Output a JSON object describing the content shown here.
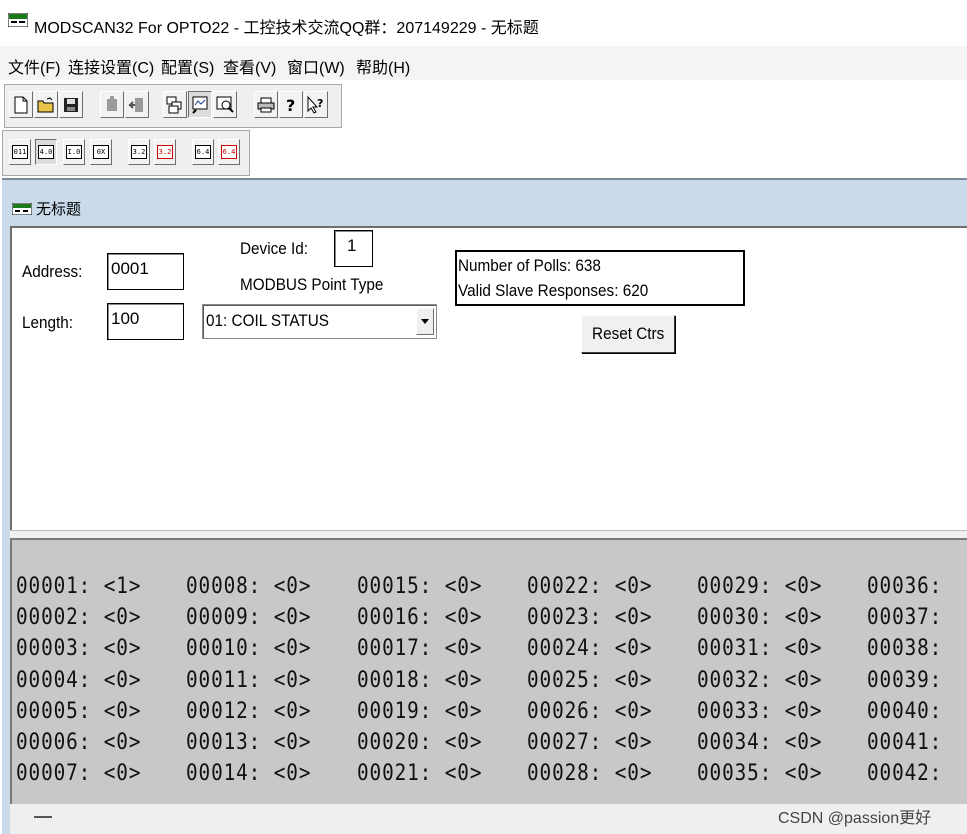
{
  "window": {
    "title": "MODSCAN32 For OPTO22 - 工控技术交流QQ群：207149229 - 无标题"
  },
  "menu": [
    "文件(F)",
    "连接设置(C)",
    "配置(S)",
    "查看(V)",
    "窗口(W)",
    "帮助(H)"
  ],
  "child_window": {
    "caption": "无标题"
  },
  "form": {
    "address_label": "Address:",
    "address_value": "0001",
    "length_label": "Length:",
    "length_value": "100",
    "device_id_label": "Device Id:",
    "device_id_value": "1",
    "point_type_label": "MODBUS Point Type",
    "point_type_value": "01: COIL STATUS",
    "polls_text": "Number of Polls: 638",
    "valid_text": "Valid Slave Responses: 620",
    "reset_label": "Reset Ctrs"
  },
  "toolbar2_labels": [
    "011",
    "4.0",
    "I.0",
    "0X",
    "3.2",
    "3.2",
    "6.4",
    "6.4"
  ],
  "data_rows": [
    [
      "00001: <1>",
      "00008: <0>",
      "00015: <0>",
      "00022: <0>",
      "00029: <0>",
      "00036:"
    ],
    [
      "00002: <0>",
      "00009: <0>",
      "00016: <0>",
      "00023: <0>",
      "00030: <0>",
      "00037:"
    ],
    [
      "00003: <0>",
      "00010: <0>",
      "00017: <0>",
      "00024: <0>",
      "00031: <0>",
      "00038:"
    ],
    [
      "00004: <0>",
      "00011: <0>",
      "00018: <0>",
      "00025: <0>",
      "00032: <0>",
      "00039:"
    ],
    [
      "00005: <0>",
      "00012: <0>",
      "00019: <0>",
      "00026: <0>",
      "00033: <0>",
      "00040:"
    ],
    [
      "00006: <0>",
      "00013: <0>",
      "00020: <0>",
      "00027: <0>",
      "00034: <0>",
      "00041:"
    ],
    [
      "00007: <0>",
      "00014: <0>",
      "00021: <0>",
      "00028: <0>",
      "00035: <0>",
      "00042:"
    ]
  ],
  "watermark": "CSDN @passion更好"
}
